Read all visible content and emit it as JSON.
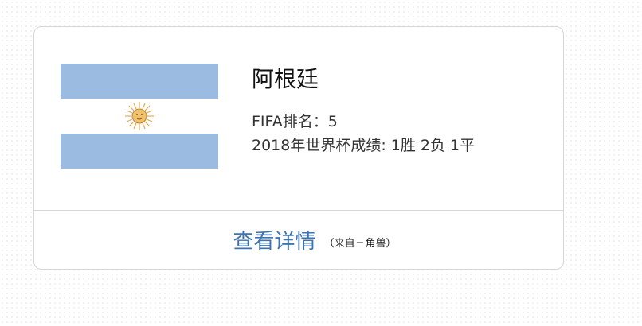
{
  "card": {
    "country_name": "阿根廷",
    "flag": {
      "icon": "argentina-flag",
      "colors": {
        "stripe": "#9bbbe0",
        "center": "#ffffff",
        "sun": "#e9b257"
      }
    },
    "fifa_rank_label": "FIFA排名：",
    "fifa_rank_value": "5",
    "worldcup_result": "2018年世界杯成绩: 1胜 2负 1平",
    "detail_link": "查看详情",
    "source_note": "（来自三角兽）"
  },
  "colors": {
    "link": "#3b73b3",
    "border": "#d6d6d6"
  }
}
